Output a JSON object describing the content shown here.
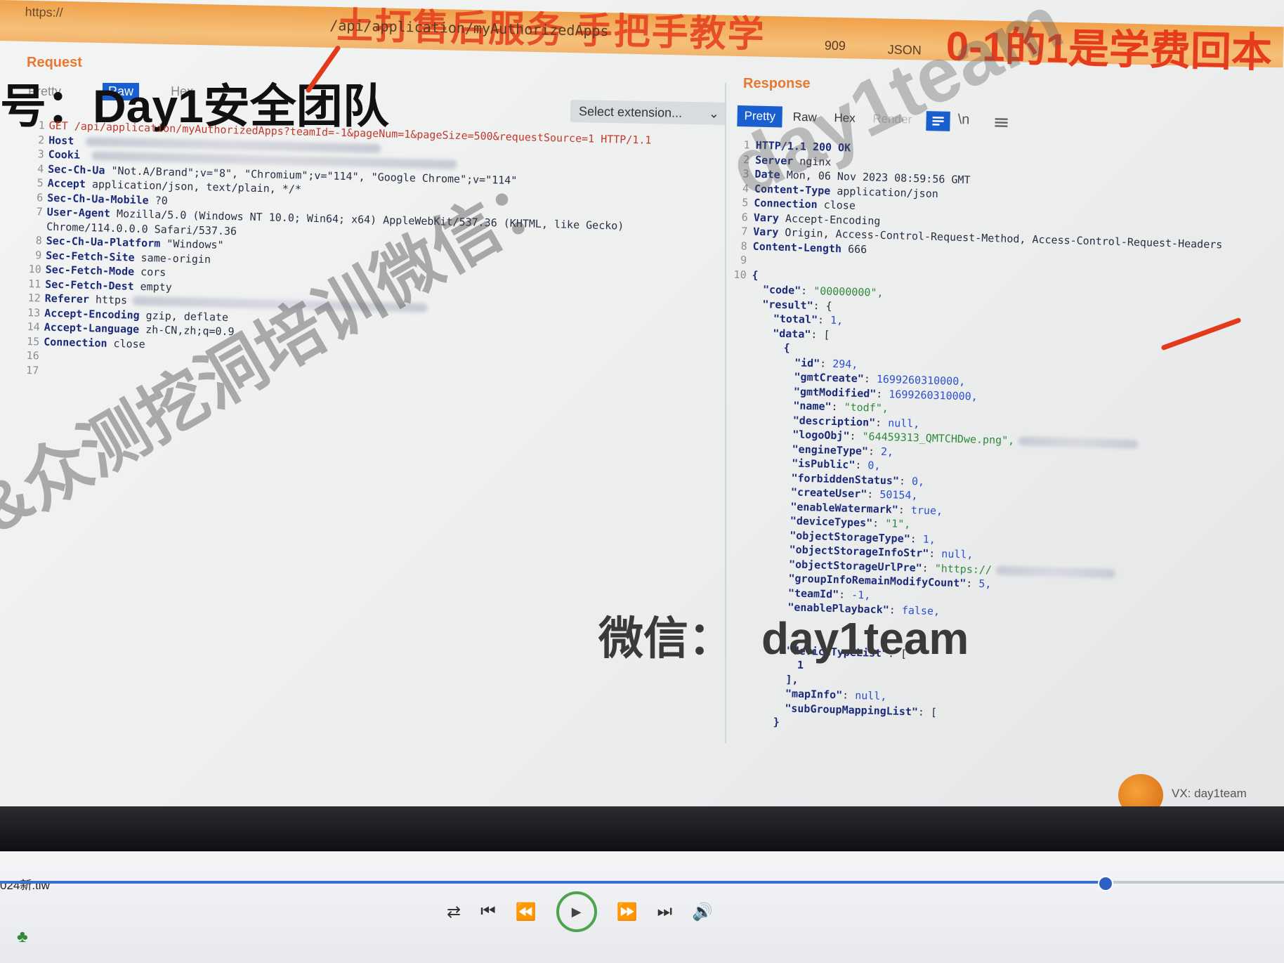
{
  "banner": {
    "url": "https://",
    "path": "/api/application/myAuthorizedApps",
    "slogan": "土打售后服务  手把手教学",
    "length": "909",
    "format": "JSON",
    "promo": "0-1的1是学费回本"
  },
  "request": {
    "title": "Request",
    "tabs": [
      "Pretty",
      "Raw",
      "Hex"
    ],
    "active_tab": "Raw",
    "ext_select": "Select extension...",
    "lines": [
      {
        "n": "1",
        "key": "",
        "text": "GET /api/application/myAuthorizedApps?teamId=-1&pageNum=1&pageSize=500&requestSource=1 HTTP/1.1"
      },
      {
        "n": "2",
        "key": "Host",
        "text": ""
      },
      {
        "n": "3",
        "key": "Cooki",
        "text": ""
      },
      {
        "n": "4",
        "key": "Sec-Ch-Ua",
        "text": "\"Not.A/Brand\";v=\"8\", \"Chromium\";v=\"114\", \"Google Chrome\";v=\"114\""
      },
      {
        "n": "5",
        "key": "Accept",
        "text": "application/json, text/plain, */*"
      },
      {
        "n": "6",
        "key": "Sec-Ch-Ua-Mobile",
        "text": "?0"
      },
      {
        "n": "7",
        "key": "User-Agent",
        "text": "Mozilla/5.0 (Windows NT 10.0; Win64; x64) AppleWebKit/537.36 (KHTML, like Gecko)"
      },
      {
        "n": "",
        "key": "",
        "text": "Chrome/114.0.0.0 Safari/537.36"
      },
      {
        "n": "8",
        "key": "Sec-Ch-Ua-Platform",
        "text": "\"Windows\""
      },
      {
        "n": "9",
        "key": "Sec-Fetch-Site",
        "text": "same-origin"
      },
      {
        "n": "10",
        "key": "Sec-Fetch-Mode",
        "text": "cors"
      },
      {
        "n": "11",
        "key": "Sec-Fetch-Dest",
        "text": "empty"
      },
      {
        "n": "12",
        "key": "Referer",
        "text": "https"
      },
      {
        "n": "13",
        "key": "Accept-Encoding",
        "text": "gzip, deflate"
      },
      {
        "n": "14",
        "key": "Accept-Language",
        "text": "zh-CN,zh;q=0.9"
      },
      {
        "n": "15",
        "key": "Connection",
        "text": "close"
      },
      {
        "n": "16",
        "key": "",
        "text": ""
      },
      {
        "n": "17",
        "key": "",
        "text": ""
      }
    ]
  },
  "team_title": "号：Day1安全团队",
  "response": {
    "title": "Response",
    "tabs": [
      "Pretty",
      "Raw",
      "Hex",
      "Render"
    ],
    "active_tab": "Pretty",
    "headers": [
      {
        "n": "1",
        "key": "HTTP/1.1 200 OK",
        "text": ""
      },
      {
        "n": "2",
        "key": "Server",
        "text": "nginx"
      },
      {
        "n": "3",
        "key": "Date",
        "text": "Mon, 06 Nov 2023 08:59:56 GMT"
      },
      {
        "n": "4",
        "key": "Content-Type",
        "text": "application/json"
      },
      {
        "n": "5",
        "key": "Connection",
        "text": "close"
      },
      {
        "n": "6",
        "key": "Vary",
        "text": "Accept-Encoding"
      },
      {
        "n": "7",
        "key": "Vary",
        "text": "Origin, Access-Control-Request-Method, Access-Control-Request-Headers"
      },
      {
        "n": "8",
        "key": "Content-Length",
        "text": "666"
      },
      {
        "n": "9",
        "key": "",
        "text": ""
      },
      {
        "n": "10",
        "key": "{",
        "text": ""
      }
    ],
    "json": [
      {
        "indent": 1,
        "key": "\"code\"",
        "val": "\"00000000\",",
        "t": "s"
      },
      {
        "indent": 1,
        "key": "\"result\"",
        "val": "{",
        "t": "p"
      },
      {
        "indent": 2,
        "key": "\"total\"",
        "val": "1,",
        "t": "n"
      },
      {
        "indent": 2,
        "key": "\"data\"",
        "val": "[",
        "t": "p"
      },
      {
        "indent": 3,
        "key": "{",
        "val": "",
        "t": "p"
      },
      {
        "indent": 4,
        "key": "\"id\"",
        "val": "294,",
        "t": "n"
      },
      {
        "indent": 4,
        "key": "\"gmtCreate\"",
        "val": "1699260310000,",
        "t": "n"
      },
      {
        "indent": 4,
        "key": "\"gmtModified\"",
        "val": "1699260310000,",
        "t": "n"
      },
      {
        "indent": 4,
        "key": "\"name\"",
        "val": "\"todf\",",
        "t": "s"
      },
      {
        "indent": 4,
        "key": "\"description\"",
        "val": "null,",
        "t": "n"
      },
      {
        "indent": 4,
        "key": "\"logoObj\"",
        "val": "\"64459313_QMTCHDwe.png\",",
        "t": "s"
      },
      {
        "indent": 4,
        "key": "\"engineType\"",
        "val": "2,",
        "t": "n"
      },
      {
        "indent": 4,
        "key": "\"isPublic\"",
        "val": "0,",
        "t": "n"
      },
      {
        "indent": 4,
        "key": "\"forbiddenStatus\"",
        "val": "0,",
        "t": "n"
      },
      {
        "indent": 4,
        "key": "\"createUser\"",
        "val": "50154,",
        "t": "n"
      },
      {
        "indent": 4,
        "key": "\"enableWatermark\"",
        "val": "true,",
        "t": "n"
      },
      {
        "indent": 4,
        "key": "\"deviceTypes\"",
        "val": "\"1\",",
        "t": "s"
      },
      {
        "indent": 4,
        "key": "\"objectStorageType\"",
        "val": "1,",
        "t": "n"
      },
      {
        "indent": 4,
        "key": "\"objectStorageInfoStr\"",
        "val": "null,",
        "t": "n"
      },
      {
        "indent": 4,
        "key": "\"objectStorageUrlPre\"",
        "val": "\"https://",
        "t": "s"
      },
      {
        "indent": 4,
        "key": "\"groupInfoRemainModifyCount\"",
        "val": "5,",
        "t": "n"
      },
      {
        "indent": 4,
        "key": "\"teamId\"",
        "val": "-1,",
        "t": "n"
      },
      {
        "indent": 4,
        "key": "\"enablePlayback\"",
        "val": "false,",
        "t": "n"
      },
      {
        "indent": 4,
        "key": "",
        "val": "",
        "t": "p"
      },
      {
        "indent": 4,
        "key": "",
        "val": "",
        "t": "p"
      },
      {
        "indent": 4,
        "key": "\"deviceTypeList\"",
        "val": "[",
        "t": "p"
      },
      {
        "indent": 5,
        "key": "1",
        "val": "",
        "t": "n"
      },
      {
        "indent": 4,
        "key": "],",
        "val": "",
        "t": "p"
      },
      {
        "indent": 4,
        "key": "\"mapInfo\"",
        "val": "null,",
        "t": "n"
      },
      {
        "indent": 4,
        "key": "\"subGroupMappingList\"",
        "val": "[",
        "t": "p"
      },
      {
        "indent": 3,
        "key": "}",
        "val": "",
        "t": "p"
      }
    ]
  },
  "watermarks": {
    "diagonal": "C&众测挖洞培训微信：",
    "id": "day1team",
    "wechat_label": "微信：",
    "wechat_id": "day1team"
  },
  "vx_badge": "VX: day1team",
  "player": {
    "file_name": "024新.tlw",
    "seek_progress": 0.86,
    "controls": [
      "repeat-icon",
      "prev-icon",
      "rewind-icon",
      "play-icon",
      "fast-forward-icon",
      "next-icon",
      "volume-icon"
    ]
  }
}
